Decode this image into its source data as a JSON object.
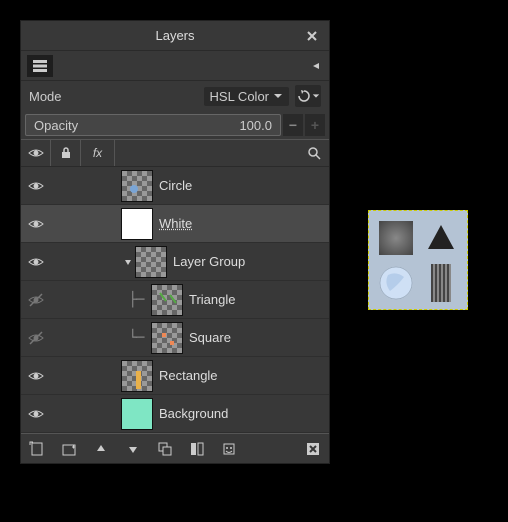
{
  "title": "Layers",
  "mode": {
    "label": "Mode",
    "value": "HSL Color"
  },
  "opacity": {
    "label": "Opacity",
    "value": "100.0"
  },
  "header": {
    "search_icon": "search"
  },
  "layers": [
    {
      "name": "Circle",
      "visible": true,
      "indent": 1,
      "thumb": "checker-blue",
      "selected": false
    },
    {
      "name": "White",
      "visible": true,
      "indent": 1,
      "thumb": "white",
      "selected": true
    },
    {
      "name": "Layer Group",
      "visible": true,
      "indent": 1,
      "thumb": "checker",
      "expandable": true,
      "expanded": true
    },
    {
      "name": "Triangle",
      "visible": false,
      "indent": 2,
      "thumb": "checker-green",
      "tree": "branch"
    },
    {
      "name": "Square",
      "visible": false,
      "indent": 2,
      "thumb": "checker-orange",
      "tree": "end"
    },
    {
      "name": "Rectangle",
      "visible": true,
      "indent": 1,
      "thumb": "checker-yellow"
    },
    {
      "name": "Background",
      "visible": true,
      "indent": 1,
      "thumb": "mint"
    }
  ],
  "bottom_buttons": [
    "new-layer",
    "new-group",
    "raise",
    "lower",
    "duplicate",
    "merge",
    "anchor",
    "mask",
    "delete"
  ]
}
